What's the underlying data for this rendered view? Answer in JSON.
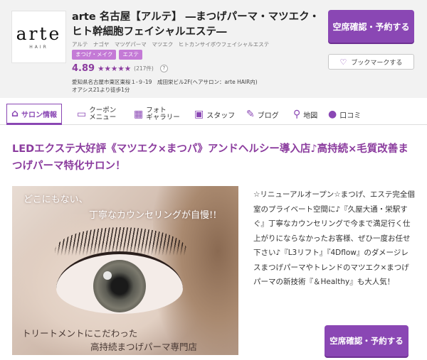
{
  "header": {
    "logo_text": "arte",
    "logo_sub": "HAIR",
    "shop_name": "arte 名古屋【アルテ】 ―まつげパーマ・マツエク・ヒト幹細胞フェイシャルエステ―",
    "kana": "アルテ　ナゴヤ　マツゲパーマ　マツエク　ヒトカンサイボウフェイシャルエステ",
    "tags": [
      "まつげ・メイク",
      "エステ"
    ],
    "rating": {
      "score": "4.89",
      "stars": "★★★★★",
      "count": "(217件)",
      "help": "?"
    },
    "address_line1": "愛知県名古屋市東区東桜１-９-19　成田栄ビル2F(ヘアサロン：arte HAIR内)",
    "address_line2": "オアシス21より徒歩1分",
    "reserve_label": "空席確認・予約する",
    "bookmark_label": "ブックマークする"
  },
  "tabs": [
    {
      "label": "サロン情報",
      "icon": "home-icon"
    },
    {
      "label": "クーポン\nメニュー",
      "icon": "ticket-icon"
    },
    {
      "label": "フォト\nギャラリー",
      "icon": "photo-icon"
    },
    {
      "label": "スタッフ",
      "icon": "staff-icon"
    },
    {
      "label": "ブログ",
      "icon": "pen-icon"
    },
    {
      "label": "地図",
      "icon": "map-pin-icon"
    },
    {
      "label": "口コミ",
      "icon": "chat-icon"
    }
  ],
  "main": {
    "catch_copy": "LEDエクステ大好評《マツエク×まつパ》アンドヘルシー導入店♪高持続×毛質改善まつげパーマ特化サロン！",
    "photo_text": {
      "line1": "どこにもない、",
      "line2": "丁寧なカウンセリングが自慢!!",
      "line3": "トリートメントにこだわった",
      "line4": "高持続まつげパーマ専門店"
    },
    "description": "☆リニューアルオープン☆まつげ、エステ完全個室のプライベート空間に♪『久屋大通・栄駅すぐ』丁寧なカウンセリングで今まで満足行く仕上がりにならなかったお客様、ぜひ一度お任せ下さい♪『L3リフト』『4Dflow』のダメージレスまつげパーマやトレンドのマツエク×まつげパーマの新技術『＆Healthy』も大人気！",
    "reserve_label": "空席確認・予約する"
  },
  "colors": {
    "accent": "#8a47b4",
    "tag": "#c47ad6",
    "header_bg": "#f2f2f2"
  }
}
